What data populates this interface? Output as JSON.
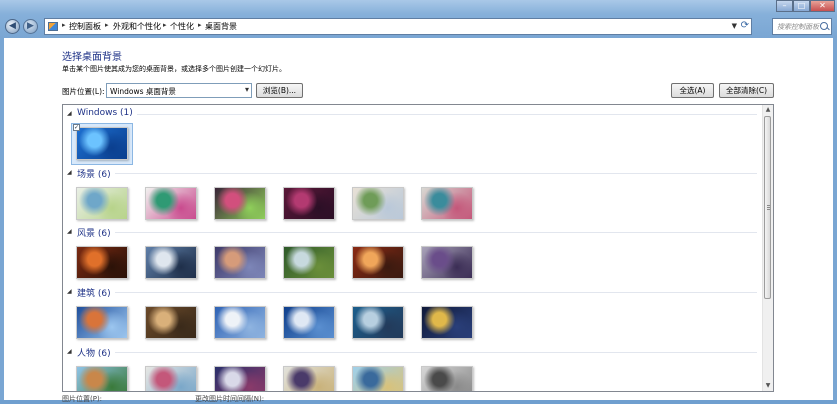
{
  "window": {
    "minimize_symbol": "–",
    "maximize_symbol": "□",
    "close_symbol": "✕",
    "close_color": "#c75050"
  },
  "address_bar": {
    "breadcrumbs": [
      "控制面板",
      "外观和个性化",
      "个性化",
      "桌面背景"
    ],
    "separator": "▸"
  },
  "search": {
    "placeholder": "搜索控制面板"
  },
  "page": {
    "title": "选择桌面背景",
    "description": "单击某个图片使其成为您的桌面背景，或选择多个图片创建一个幻灯片。"
  },
  "location": {
    "label": "图片位置(L):",
    "selected": "Windows 桌面背景",
    "browse_label": "浏览(B)...",
    "select_all_label": "全选(A)",
    "clear_all_label": "全部清除(C)"
  },
  "groups": [
    {
      "title": "Windows (1)",
      "items": [
        {
          "name": "windows-7-default",
          "selected": true,
          "c1": "#1d6fd0",
          "c2": "#6cc3ff",
          "c3": "#0b3f8f"
        }
      ]
    },
    {
      "title": "场景 (6)",
      "items": [
        {
          "name": "scene-1",
          "c1": "#e9efe6",
          "c2": "#6fa7c9",
          "c3": "#b7d38a"
        },
        {
          "name": "scene-2",
          "c1": "#f1f1ef",
          "c2": "#2f9a74",
          "c3": "#c94b8e"
        },
        {
          "name": "scene-3",
          "c1": "#3a2438",
          "c2": "#d24f7d",
          "c3": "#8fcf5a"
        },
        {
          "name": "scene-4",
          "c1": "#5a1838",
          "c2": "#b33a71",
          "c3": "#2b0f26"
        },
        {
          "name": "scene-5",
          "c1": "#e8e1d6",
          "c2": "#6f9c58",
          "c3": "#b9c8d9"
        },
        {
          "name": "scene-6",
          "c1": "#d8d8d2",
          "c2": "#3a8c9c",
          "c3": "#c4577a"
        }
      ]
    },
    {
      "title": "风景 (6)",
      "items": [
        {
          "name": "landscape-1",
          "c1": "#7a2a12",
          "c2": "#e0702a",
          "c3": "#2b1208"
        },
        {
          "name": "landscape-2",
          "c1": "#5f7fa8",
          "c2": "#dfe6ee",
          "c3": "#1f2f4a"
        },
        {
          "name": "landscape-3",
          "c1": "#3e3a6a",
          "c2": "#d69b7a",
          "c3": "#7d86b8"
        },
        {
          "name": "landscape-4",
          "c1": "#2e5a2a",
          "c2": "#c7d9de",
          "c3": "#6b8f3a"
        },
        {
          "name": "landscape-5",
          "c1": "#8a2a14",
          "c2": "#f0a65a",
          "c3": "#3a1a10"
        },
        {
          "name": "landscape-6",
          "c1": "#a9a3b9",
          "c2": "#6a4d8a",
          "c3": "#3b2d55"
        }
      ]
    },
    {
      "title": "建筑 (6)",
      "items": [
        {
          "name": "architecture-1",
          "c1": "#1f4f9c",
          "c2": "#d9743a",
          "c3": "#9cc6ef"
        },
        {
          "name": "architecture-2",
          "c1": "#6b4a2a",
          "c2": "#d9b07a",
          "c3": "#3a2a1a"
        },
        {
          "name": "architecture-3",
          "c1": "#2f63b5",
          "c2": "#eef2f7",
          "c3": "#8fb4e0"
        },
        {
          "name": "architecture-4",
          "c1": "#0f3f8c",
          "c2": "#dfe8f4",
          "c3": "#5a8fd0"
        },
        {
          "name": "architecture-5",
          "c1": "#1c5e8c",
          "c2": "#b7cfe0",
          "c3": "#233a5a"
        },
        {
          "name": "architecture-6",
          "c1": "#101a3a",
          "c2": "#e0b84a",
          "c3": "#2a3f7a"
        }
      ]
    },
    {
      "title": "人物 (6)",
      "items": [
        {
          "name": "characters-1",
          "c1": "#8fc3e6",
          "c2": "#c9874a",
          "c3": "#3a7a3a"
        },
        {
          "name": "characters-2",
          "c1": "#e7e7e4",
          "c2": "#c4577a",
          "c3": "#7aa7c9"
        },
        {
          "name": "characters-3",
          "c1": "#2a2f6a",
          "c2": "#d9d9e8",
          "c3": "#8a3a6a"
        },
        {
          "name": "characters-4",
          "c1": "#e2e2dc",
          "c2": "#4a3a6a",
          "c3": "#c9b27a"
        },
        {
          "name": "characters-5",
          "c1": "#9fd0ea",
          "c2": "#3a6a9c",
          "c3": "#d9c27a"
        },
        {
          "name": "characters-6",
          "c1": "#d6d6d6",
          "c2": "#4a4a4a",
          "c3": "#8a8a8a"
        }
      ]
    }
  ],
  "bottom": {
    "position_label": "图片位置(P):",
    "interval_label": "更改图片时间间隔(N):"
  }
}
